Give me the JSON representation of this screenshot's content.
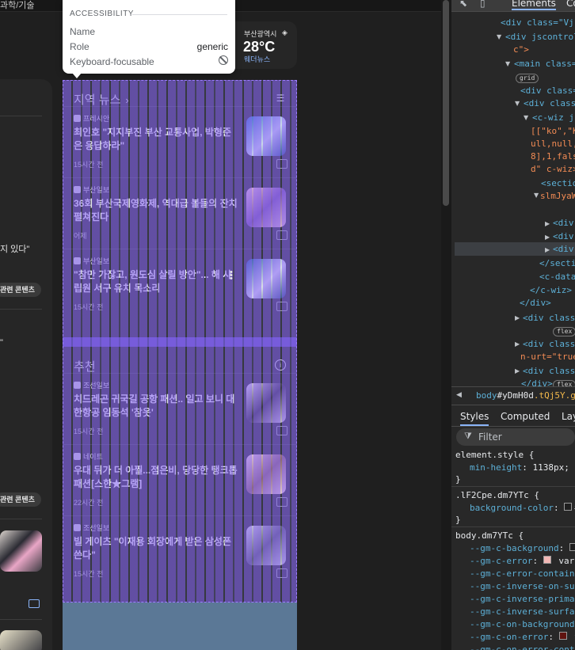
{
  "page": {
    "top_strip_text": "과학/기술",
    "weather": {
      "city": "부산광역시",
      "temp": "28°C",
      "source": "웨더뉴스"
    },
    "left_column": {
      "snippet_1": "지 있다\"",
      "snippet_2": "\"",
      "chip_1": "관련 콘텐츠",
      "chip_2": "관련 콘텐츠"
    },
    "card": {
      "section1_title": "지역 뉴스",
      "section2_title": "추천",
      "section1_articles": [
        {
          "source": "프레시안",
          "title": "최인호 \"지지부진 부산 교통사업, 박형준은 응답하라\"",
          "time": "15시간 전"
        },
        {
          "source": "부산일보",
          "title": "36회 부산국제영화제, 역대급 볼들의 잔치 펼쳐진다",
          "time": "어제"
        },
        {
          "source": "부산일보",
          "title": "\"참만 가잖고, 원도심 살릴 방안\"... 해 사립원 서구 유치 목소리",
          "time": "15시간 전"
        }
      ],
      "section2_articles": [
        {
          "source": "조선일보",
          "title": "치드레곤 귀국길 공항 패션.. 일고 보니 대한항공 임동석 '참옷'",
          "time": "15시간 전"
        },
        {
          "source": "네이트",
          "title": "우대 뒤가 더 아찔...점은비, 당당한 탱크톱 패션[스한★그램]",
          "time": "22시간 전"
        },
        {
          "source": "조선일보",
          "title": "빌 게이츠 \"이재용 회장에게 받은 삼성폰 쓴다\"",
          "time": "15시간 전"
        }
      ]
    }
  },
  "tooltip": {
    "header": "ACCESSIBILITY",
    "rows": [
      {
        "label": "Name",
        "value": ""
      },
      {
        "label": "Role",
        "value": "generic"
      },
      {
        "label": "Keyboard-focusable",
        "value": ""
      }
    ]
  },
  "devtools": {
    "tabs": [
      "Elements",
      "Co"
    ],
    "dom_lines": [
      "<div class=\"VjFx",
      "<div jscontroll",
      "c\">",
      "<main class=\"",
      "grid",
      "<div class=",
      "<div class=",
      "<c-wiz js",
      "[[\"ko\",\"KI",
      "ull,null,",
      "8],1,false",
      "d\" c-wiz>",
      "<sectio",
      "slmJyaW",
      "<div",
      "<div",
      "<div",
      "</sectio",
      "<c-data",
      "</c-wiz>",
      "</div>",
      "<div class=",
      "flex",
      "<div class=",
      "n-urt=\"true",
      "<div class=",
      "</div>",
      "flex"
    ],
    "breadcrumb": {
      "tag": "body",
      "id": "#yDmH0d",
      "cls": ".tQj5Y.g"
    },
    "subtabs": [
      "Styles",
      "Computed",
      "Lay"
    ],
    "filter_placeholder": "Filter",
    "styles": {
      "element_style": "element.style {",
      "min_height_prop": "min-height",
      "min_height_val": "1138px;",
      "close1": "}",
      "rule2_selector": ".lF2Cpe.dm7YTc {",
      "rule2_prop": "background-color",
      "rule2_val": "#",
      "close2": "}",
      "rule3_selector": "body.dm7YTc {",
      "vars": [
        "--gm-c-background",
        "--gm-c-error",
        "--gm-c-error-container",
        "--gm-c-inverse-on-surf",
        "--gm-c-inverse-primary",
        "--gm-c-inverse-surface",
        "--gm-c-on-background",
        "--gm-c-on-error",
        "--gm-c-on-error-conta",
        "--gm-c-on-primary"
      ],
      "var_error_val": "var(--",
      "var_on_error_val": "va"
    }
  },
  "colors": {
    "accent": "#8ab4f8",
    "overlay": "#8a63ff"
  }
}
